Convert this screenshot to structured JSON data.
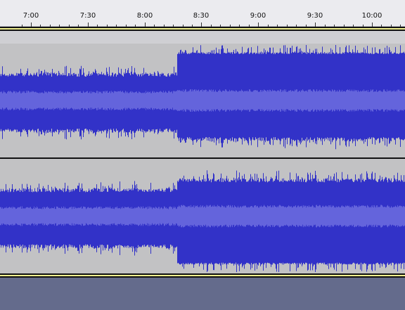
{
  "timeline": {
    "labels": [
      "7:00",
      "7:30",
      "8:00",
      "8:30",
      "9:00",
      "9:30",
      "10:00"
    ]
  },
  "colors": {
    "ruler_bg": "#ebebef",
    "track_bg": "#c2c2c4",
    "waveform_peak": "#3232c8",
    "waveform_rms": "#6464dc",
    "separator_dark": "#111111",
    "separator_yellow": "#f3f391",
    "empty_area": "#646b8c"
  }
}
